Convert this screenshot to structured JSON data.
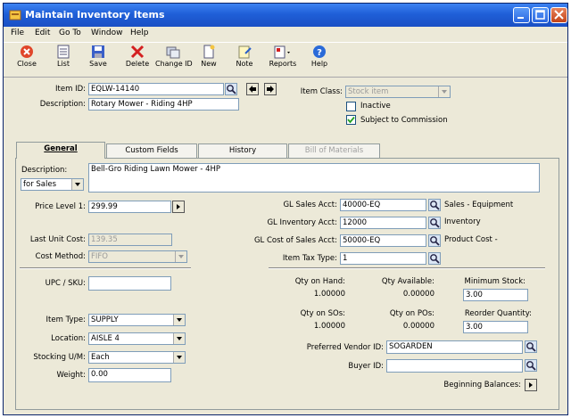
{
  "window": {
    "title": "Maintain Inventory Items"
  },
  "menu": [
    "File",
    "Edit",
    "Go To",
    "Window",
    "Help"
  ],
  "toolbar": [
    {
      "label": "Close",
      "icon": "close-icon"
    },
    {
      "label": "List",
      "icon": "list-icon"
    },
    {
      "label": "Save",
      "icon": "save-icon"
    },
    {
      "label": "Delete",
      "icon": "delete-icon"
    },
    {
      "label": "Change ID",
      "icon": "change-id-icon"
    },
    {
      "label": "New",
      "icon": "new-icon"
    },
    {
      "label": "Note",
      "icon": "note-icon"
    },
    {
      "label": "Reports",
      "icon": "reports-icon"
    },
    {
      "label": "Help",
      "icon": "help-icon"
    }
  ],
  "header": {
    "item_id_label": "Item ID:",
    "item_id": "EQLW-14140",
    "description_label": "Description:",
    "description": "Rotary Mower - Riding 4HP",
    "item_class_label": "Item Class:",
    "item_class": "Stock item",
    "inactive_label": "Inactive",
    "inactive": false,
    "commission_label": "Subject to Commission",
    "commission": true
  },
  "tabs": [
    "General",
    "Custom Fields",
    "History",
    "Bill of Materials"
  ],
  "general": {
    "description_label": "Description:",
    "description_for": "for Sales",
    "long_description": "Bell-Gro Riding Lawn Mower - 4HP",
    "price_level_label": "Price Level 1:",
    "price_level_1": "299.99",
    "last_unit_cost_label": "Last Unit Cost:",
    "last_unit_cost": "139.35",
    "cost_method_label": "Cost Method:",
    "cost_method": "FIFO",
    "gl_sales_label": "GL Sales Acct:",
    "gl_sales": "40000-EQ",
    "gl_sales_desc": "Sales - Equipment",
    "gl_inventory_label": "GL Inventory Acct:",
    "gl_inventory": "12000",
    "gl_inventory_desc": "Inventory",
    "gl_cost_label": "GL Cost of Sales Acct:",
    "gl_cost": "50000-EQ",
    "gl_cost_desc": "Product Cost -",
    "tax_type_label": "Item Tax Type:",
    "tax_type": "1",
    "upc_label": "UPC / SKU:",
    "upc": "",
    "item_type_label": "Item Type:",
    "item_type": "SUPPLY",
    "location_label": "Location:",
    "location": "AISLE 4",
    "stocking_um_label": "Stocking U/M:",
    "stocking_um": "Each",
    "weight_label": "Weight:",
    "weight": "0.00",
    "qty_on_hand_label": "Qty on Hand:",
    "qty_on_hand": "1.00000",
    "qty_available_label": "Qty Available:",
    "qty_available": "0.00000",
    "min_stock_label": "Minimum Stock:",
    "min_stock": "3.00",
    "qty_on_sos_label": "Qty on SOs:",
    "qty_on_sos": "1.00000",
    "qty_on_pos_label": "Qty on POs:",
    "qty_on_pos": "0.00000",
    "reorder_qty_label": "Reorder Quantity:",
    "reorder_qty": "3.00",
    "pref_vendor_label": "Preferred Vendor ID:",
    "pref_vendor": "SOGARDEN",
    "buyer_label": "Buyer ID:",
    "buyer": "",
    "beginning_balances_label": "Beginning Balances:"
  }
}
